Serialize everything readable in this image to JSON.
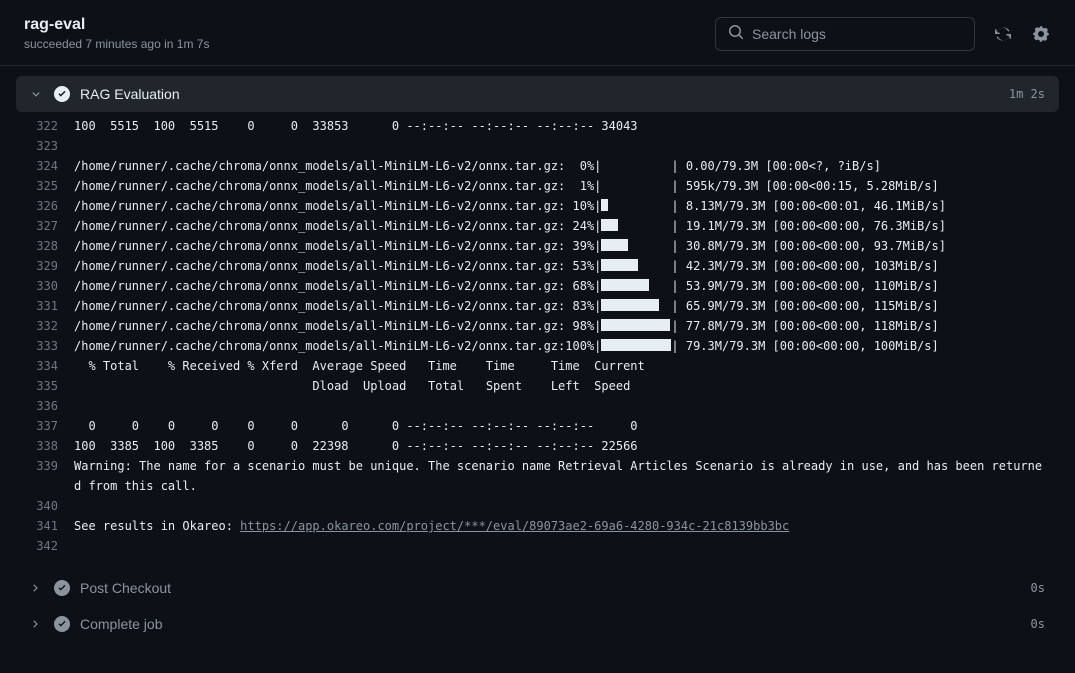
{
  "header": {
    "title": "rag-eval",
    "subtitle": "succeeded 7 minutes ago in 1m 7s",
    "search_placeholder": "Search logs"
  },
  "steps": {
    "expanded": {
      "label": "RAG Evaluation",
      "duration": "1m 2s"
    },
    "post_checkout": {
      "label": "Post Checkout",
      "duration": "0s"
    },
    "complete_job": {
      "label": "Complete job",
      "duration": "0s"
    }
  },
  "log": {
    "path": "/home/runner/.cache/chroma/onnx_models/all-MiniLM-L6-v2/onnx.tar.gz:",
    "lines": [
      {
        "n": 322,
        "t": "100  5515  100  5515    0     0  33853      0 --:--:-- --:--:-- --:--:-- 34043"
      },
      {
        "n": 323,
        "t": ""
      },
      {
        "n": 324,
        "pct": "  0%",
        "bw": 0,
        "rest": "| 0.00/79.3M [00:00<?, ?iB/s]"
      },
      {
        "n": 325,
        "pct": "  1%",
        "bw": 0,
        "rest": "| 595k/79.3M [00:00<00:15, 5.28MiB/s]"
      },
      {
        "n": 326,
        "pct": " 10%",
        "bw": 7,
        "rest": "| 8.13M/79.3M [00:00<00:01, 46.1MiB/s]"
      },
      {
        "n": 327,
        "pct": " 24%",
        "bw": 17,
        "rest": "| 19.1M/79.3M [00:00<00:00, 76.3MiB/s]"
      },
      {
        "n": 328,
        "pct": " 39%",
        "bw": 27,
        "rest": "| 30.8M/79.3M [00:00<00:00, 93.7MiB/s]"
      },
      {
        "n": 329,
        "pct": " 53%",
        "bw": 37,
        "rest": "| 42.3M/79.3M [00:00<00:00, 103MiB/s]"
      },
      {
        "n": 330,
        "pct": " 68%",
        "bw": 48,
        "rest": "| 53.9M/79.3M [00:00<00:00, 110MiB/s]"
      },
      {
        "n": 331,
        "pct": " 83%",
        "bw": 58,
        "rest": "| 65.9M/79.3M [00:00<00:00, 115MiB/s]"
      },
      {
        "n": 332,
        "pct": " 98%",
        "bw": 69,
        "rest": "| 77.8M/79.3M [00:00<00:00, 118MiB/s]"
      },
      {
        "n": 333,
        "pct": "100%",
        "bw": 70,
        "rest": "| 79.3M/79.3M [00:00<00:00, 100MiB/s]"
      },
      {
        "n": 334,
        "t": "  % Total    % Received % Xferd  Average Speed   Time    Time     Time  Current"
      },
      {
        "n": 335,
        "t": "                                 Dload  Upload   Total   Spent    Left  Speed"
      },
      {
        "n": 336,
        "t": ""
      },
      {
        "n": 337,
        "t": "  0     0    0     0    0     0      0      0 --:--:-- --:--:-- --:--:--     0"
      },
      {
        "n": 338,
        "t": "100  3385  100  3385    0     0  22398      0 --:--:-- --:--:-- --:--:-- 22566"
      },
      {
        "n": 339,
        "t": "Warning: The name for a scenario must be unique. The scenario name Retrieval Articles Scenario is already in use, and has been returned from this call."
      },
      {
        "n": 340,
        "t": ""
      },
      {
        "n": 341,
        "link_prefix": "See results in Okareo: ",
        "link": "https://app.okareo.com/project/***/eval/89073ae2-69a6-4280-934c-21c8139bb3bc"
      },
      {
        "n": 342,
        "t": ""
      }
    ],
    "bar_total_width": 70
  }
}
